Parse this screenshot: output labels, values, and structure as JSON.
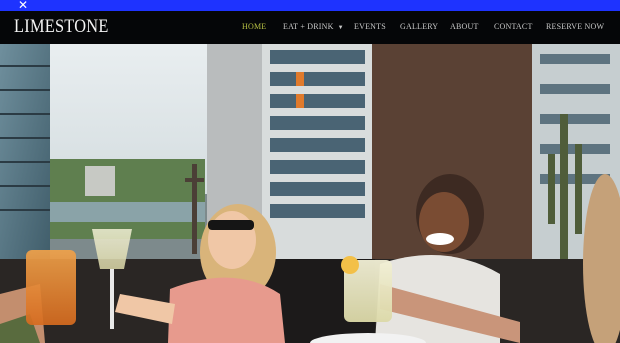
{
  "banner": {
    "close_icon": "close-icon",
    "color": "#1e33ff"
  },
  "header": {
    "logo": "LIMESTONE",
    "background": "#050608",
    "nav": [
      {
        "label": "HOME",
        "active": true
      },
      {
        "label": "EAT + DRINK",
        "dropdown": true
      },
      {
        "label": "EVENTS"
      },
      {
        "label": "GALLERY"
      },
      {
        "label": "ABOUT"
      },
      {
        "label": "CONTACT"
      },
      {
        "label": "RESERVE NOW"
      }
    ],
    "accent": "#b7c043"
  },
  "hero": {
    "type": "photo",
    "subject": "rooftop-toast-photo"
  }
}
